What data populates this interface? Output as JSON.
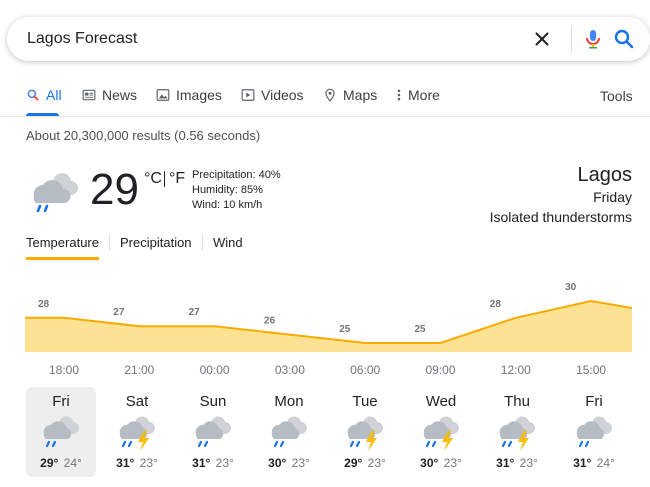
{
  "search": {
    "query": "Lagos Forecast"
  },
  "tabs": [
    {
      "label": "All",
      "icon": "search-icon"
    },
    {
      "label": "News",
      "icon": "news-icon"
    },
    {
      "label": "Images",
      "icon": "image-icon"
    },
    {
      "label": "Videos",
      "icon": "video-icon"
    },
    {
      "label": "Maps",
      "icon": "map-pin-icon"
    },
    {
      "label": "More",
      "icon": "more-vert-icon"
    }
  ],
  "tools_label": "Tools",
  "result_stats": "About 20,300,000 results (0.56 seconds)",
  "weather": {
    "temperature": "29",
    "unit_c": "°C",
    "unit_f": "°F",
    "precipitation": "Precipitation: 40%",
    "humidity": "Humidity: 85%",
    "wind": "Wind: 10 km/h",
    "location": "Lagos",
    "day": "Friday",
    "condition": "Isolated thunderstorms"
  },
  "subtabs": [
    "Temperature",
    "Precipitation",
    "Wind"
  ],
  "chart_data": {
    "type": "area",
    "x": [
      "18:00",
      "21:00",
      "00:00",
      "03:00",
      "06:00",
      "09:00",
      "12:00",
      "15:00"
    ],
    "values": [
      28,
      27,
      27,
      26,
      25,
      25,
      28,
      30
    ],
    "point_labels": [
      "28",
      "27",
      "27",
      "26",
      "25",
      "25",
      "28",
      "30"
    ],
    "colors": {
      "line": "#f9ab00",
      "fill": "#fde293"
    }
  },
  "days": [
    {
      "name": "Fri",
      "hi": "29°",
      "lo": "24°",
      "icon": "rain-cloud-icon",
      "selected": true
    },
    {
      "name": "Sat",
      "hi": "31°",
      "lo": "23°",
      "icon": "thunderstorm-icon"
    },
    {
      "name": "Sun",
      "hi": "31°",
      "lo": "23°",
      "icon": "rain-cloud-icon"
    },
    {
      "name": "Mon",
      "hi": "30°",
      "lo": "23°",
      "icon": "rain-cloud-icon"
    },
    {
      "name": "Tue",
      "hi": "29°",
      "lo": "23°",
      "icon": "thunderstorm-icon"
    },
    {
      "name": "Wed",
      "hi": "30°",
      "lo": "23°",
      "icon": "thunderstorm-icon"
    },
    {
      "name": "Thu",
      "hi": "31°",
      "lo": "23°",
      "icon": "thunderstorm-icon"
    },
    {
      "name": "Fri",
      "hi": "31°",
      "lo": "24°",
      "icon": "rain-cloud-icon"
    }
  ],
  "colors": {
    "accent_blue": "#1a73e8",
    "accent_orange": "#f9ab00"
  }
}
